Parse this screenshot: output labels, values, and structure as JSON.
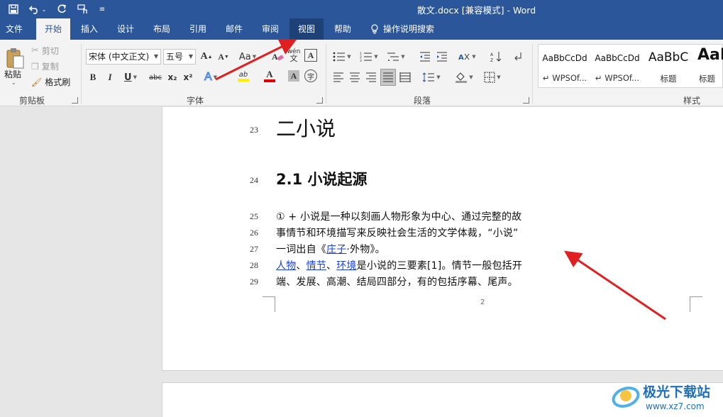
{
  "titlebar": {
    "title": "散文.docx [兼容模式]  -  Word",
    "quick_access": [
      "save-icon",
      "undo-icon",
      "redo-icon",
      "touch-mode-icon",
      "customize-icon"
    ]
  },
  "tabs": [
    {
      "label": "文件"
    },
    {
      "label": "开始"
    },
    {
      "label": "插入"
    },
    {
      "label": "设计"
    },
    {
      "label": "布局"
    },
    {
      "label": "引用"
    },
    {
      "label": "邮件"
    },
    {
      "label": "审阅"
    },
    {
      "label": "视图"
    },
    {
      "label": "帮助"
    }
  ],
  "tell_me": "操作说明搜索",
  "clipboard": {
    "paste": "粘贴",
    "cut": "剪切",
    "copy": "复制",
    "format_painter": "格式刷",
    "group": "剪贴板"
  },
  "font": {
    "name": "宋体 (中文正文)",
    "size": "五号",
    "grow": "A",
    "shrink": "A",
    "change_case": "Aa",
    "phonetic": "wén",
    "bold": "B",
    "italic": "I",
    "underline": "U",
    "strike": "abc",
    "subscript": "x₂",
    "superscript": "x²",
    "text_effects": "A",
    "highlight": "ab",
    "font_color": "A",
    "char_shading": "A",
    "enclose": "字",
    "group": "字体",
    "highlight_color": "#ffef00",
    "font_color_value": "#e00000"
  },
  "paragraph": {
    "group": "段落"
  },
  "styles": {
    "group": "样式",
    "items": [
      {
        "sample": "AaBbCcDd",
        "name": "↵ WPSOf..."
      },
      {
        "sample": "AaBbCcDd",
        "name": "↵ WPSOf..."
      },
      {
        "sample": "AaBbC",
        "name": "标题"
      },
      {
        "sample": "AaB",
        "name": "标题"
      }
    ]
  },
  "document": {
    "line_numbers": [
      "23",
      "24",
      "25",
      "26",
      "27",
      "28",
      "29"
    ],
    "heading1": "二小说",
    "heading2": "2.1 小说起源",
    "lines": {
      "l25": "① + 小说是一种以刻画人物形象为中心、通过完整的故",
      "l26": "事情节和环境描写来反映社会生活的文学体裁，“小说”",
      "l27a": "一词出自《",
      "l27link": "庄子",
      "l27b": "·外物》。",
      "l28link1": "人物",
      "l28sep1": "、",
      "l28link2": "情节",
      "l28sep2": "、",
      "l28link3": "环境",
      "l28rest": "是小说的三要素[1]。情节一般包括开",
      "l29": "端、发展、高潮、结局四部分，有的包括序幕、尾声。"
    },
    "page_number": "2"
  },
  "watermark": {
    "text1": "极光下载站",
    "text2": "www.xz7.com"
  },
  "colors": {
    "word_blue": "#2b579a",
    "annotation_arrow": "#e02020",
    "link": "#1a3fd6"
  }
}
